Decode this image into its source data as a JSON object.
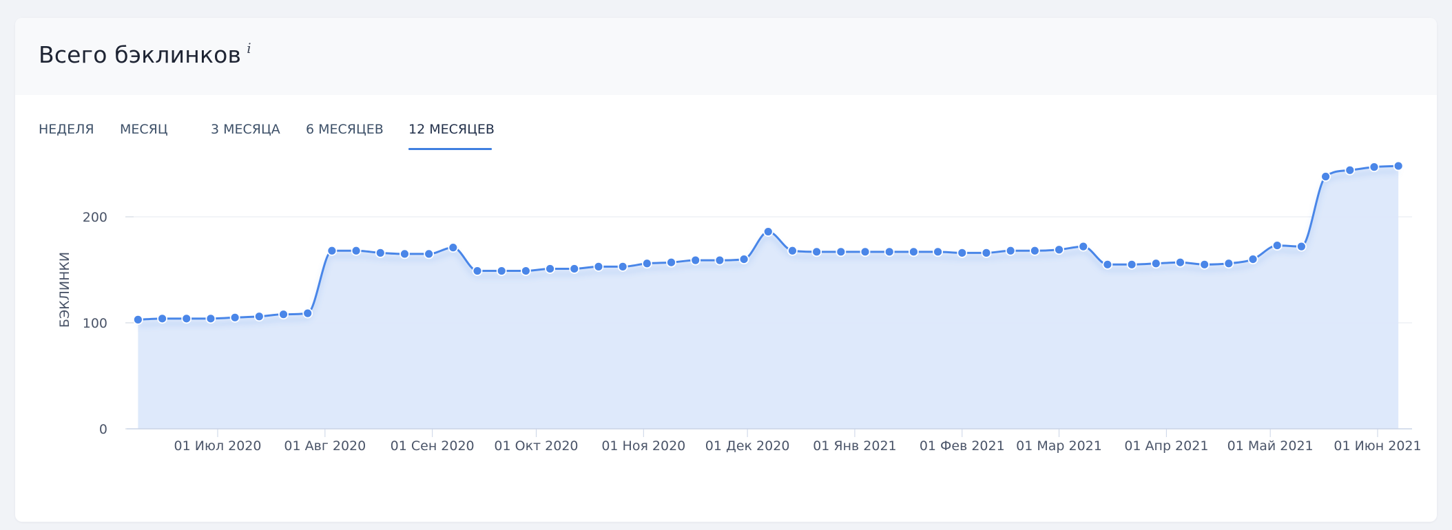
{
  "title": "Всего бэклинков",
  "info_icon": "i",
  "tabs": [
    {
      "label": "НЕДЕЛЯ",
      "active": false
    },
    {
      "label": "МЕСЯЦ",
      "active": false
    },
    {
      "label": "3 МЕСЯЦА",
      "active": false
    },
    {
      "label": "6 МЕСЯЦЕВ",
      "active": false
    },
    {
      "label": "12 МЕСЯЦЕВ",
      "active": true
    }
  ],
  "colors": {
    "line": "#4a86e8",
    "area": "#dce8fb",
    "active_tab_underline": "#3f7fe0"
  },
  "chart_data": {
    "type": "area",
    "ylabel": "БЭКЛИНКИ",
    "xlabel": "",
    "ylim": [
      0,
      250
    ],
    "yticks": [
      0,
      100,
      200
    ],
    "grid": true,
    "legend": "none",
    "x_tick_labels": [
      {
        "date": "2020-07-01",
        "label": "01 Июл 2020"
      },
      {
        "date": "2020-08-01",
        "label": "01 Авг 2020"
      },
      {
        "date": "2020-09-01",
        "label": "01 Сен 2020"
      },
      {
        "date": "2020-10-01",
        "label": "01 Окт 2020"
      },
      {
        "date": "2020-11-01",
        "label": "01 Ноя 2020"
      },
      {
        "date": "2020-12-01",
        "label": "01 Дек 2020"
      },
      {
        "date": "2021-01-01",
        "label": "01 Янв 2021"
      },
      {
        "date": "2021-02-01",
        "label": "01 Фев 2021"
      },
      {
        "date": "2021-03-01",
        "label": "01 Мар 2021"
      },
      {
        "date": "2021-04-01",
        "label": "01 Апр 2021"
      },
      {
        "date": "2021-05-01",
        "label": "01 Май 2021"
      },
      {
        "date": "2021-06-01",
        "label": "01 Июн 2021"
      }
    ],
    "x": [
      "2020-06-08",
      "2020-06-15",
      "2020-06-22",
      "2020-06-29",
      "2020-07-06",
      "2020-07-13",
      "2020-07-20",
      "2020-07-27",
      "2020-08-03",
      "2020-08-10",
      "2020-08-17",
      "2020-08-24",
      "2020-08-31",
      "2020-09-07",
      "2020-09-14",
      "2020-09-21",
      "2020-09-28",
      "2020-10-05",
      "2020-10-12",
      "2020-10-19",
      "2020-10-26",
      "2020-11-02",
      "2020-11-09",
      "2020-11-16",
      "2020-11-23",
      "2020-11-30",
      "2020-12-07",
      "2020-12-14",
      "2020-12-21",
      "2020-12-28",
      "2021-01-04",
      "2021-01-11",
      "2021-01-18",
      "2021-01-25",
      "2021-02-01",
      "2021-02-08",
      "2021-02-15",
      "2021-02-22",
      "2021-03-01",
      "2021-03-08",
      "2021-03-15",
      "2021-03-22",
      "2021-03-29",
      "2021-04-05",
      "2021-04-12",
      "2021-04-19",
      "2021-04-26",
      "2021-05-03",
      "2021-05-10",
      "2021-05-17",
      "2021-05-24",
      "2021-05-31",
      "2021-06-07"
    ],
    "values": [
      103,
      104,
      104,
      104,
      105,
      106,
      108,
      109,
      168,
      168,
      166,
      165,
      165,
      171,
      149,
      149,
      149,
      151,
      151,
      153,
      153,
      156,
      157,
      159,
      159,
      160,
      186,
      168,
      167,
      167,
      167,
      167,
      167,
      167,
      166,
      166,
      168,
      168,
      169,
      172,
      155,
      155,
      156,
      157,
      155,
      156,
      160,
      173,
      172,
      238,
      244,
      247,
      248
    ]
  }
}
